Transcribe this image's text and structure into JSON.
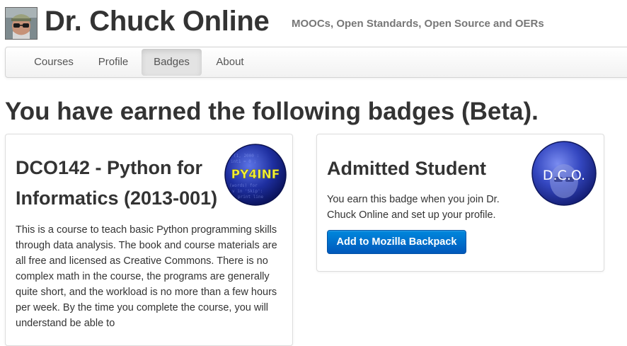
{
  "header": {
    "title": "Dr. Chuck Online",
    "tagline": "MOOCs, Open Standards, Open Source and OERs",
    "avatar_icon": "user-avatar-photo"
  },
  "nav": {
    "items": [
      {
        "label": "Courses",
        "active": false
      },
      {
        "label": "Profile",
        "active": false
      },
      {
        "label": "Badges",
        "active": true
      },
      {
        "label": "About",
        "active": false
      }
    ]
  },
  "main": {
    "heading": "You have earned the following badges (Beta)."
  },
  "badges": [
    {
      "title": "DCO142 - Python for Informatics (2013-001)",
      "badge_text": "PY4INF",
      "description": "This is a course to teach basic Python programming skills through data analysis. The book and course materials are all free and licensed as Creative Commons. There is no complex math in the course, the programs are generally quite short, and the workload is no more than a few hours per week. By the time you complete the course, you will understand be able to",
      "badge_color": "#2a3db0"
    },
    {
      "title": "Admitted Student",
      "badge_text": "D.C.O.",
      "description": "You earn this badge when you join Dr. Chuck Online and set up your profile.",
      "button_label": "Add to Mozilla Backpack",
      "badge_color": "#3a55c8"
    }
  ],
  "colors": {
    "accent_button": "#0070cc",
    "text": "#333333",
    "muted": "#777777"
  }
}
